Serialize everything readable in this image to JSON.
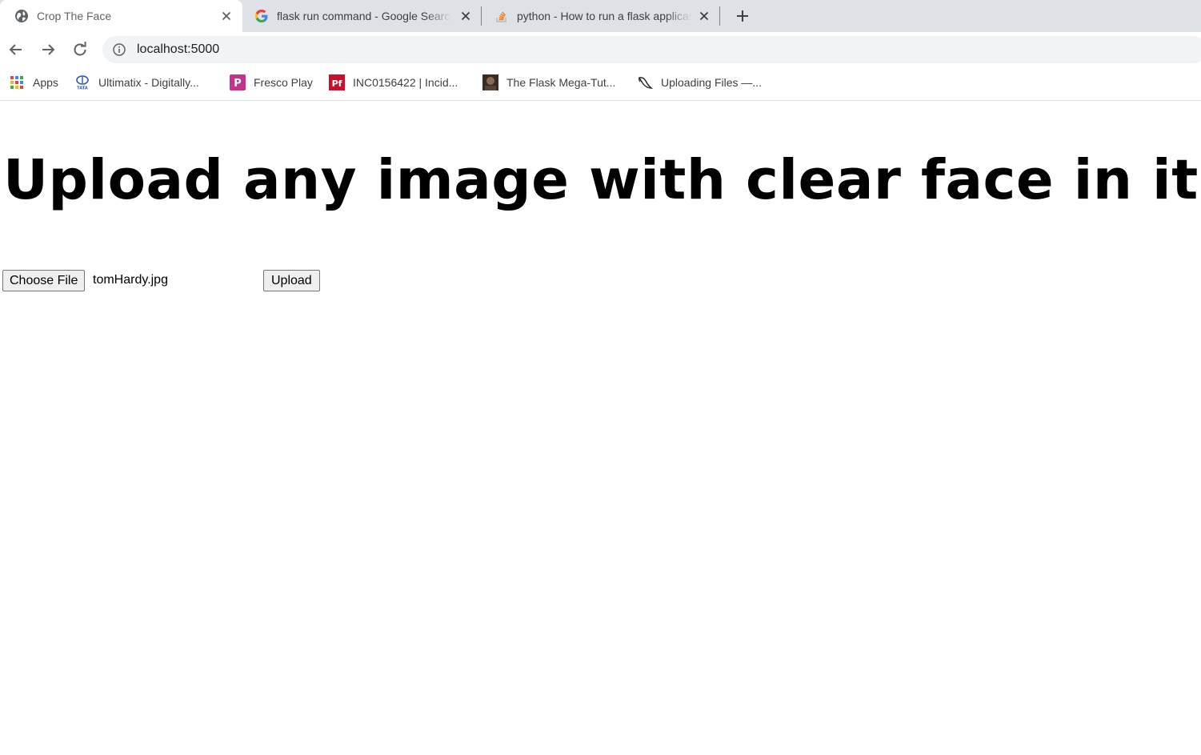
{
  "browser": {
    "tabs": [
      {
        "title": "Crop The Face",
        "icon": "globe-icon",
        "active": true
      },
      {
        "title": "flask run command - Google Search",
        "icon": "google-icon",
        "active": false
      },
      {
        "title": "python - How to run a flask application",
        "icon": "stackoverflow-icon",
        "active": false
      }
    ],
    "new_tab_icon": "plus-icon",
    "address": {
      "url": "localhost:5000",
      "icon": "info-icon"
    },
    "bookmarks": [
      {
        "label": "Apps",
        "icon": "apps-grid-icon"
      },
      {
        "label": "Ultimatix - Digitally...",
        "icon": "tata-icon"
      },
      {
        "label": "Fresco Play",
        "icon": "fresco-icon"
      },
      {
        "label": "INC0156422 | Incid...",
        "icon": "pf-icon"
      },
      {
        "label": "The Flask Mega-Tut...",
        "icon": "avatar-icon"
      },
      {
        "label": "Uploading Files —...",
        "icon": "flask-horn-icon"
      }
    ]
  },
  "page": {
    "heading": "Upload any image with clear face in it.",
    "file_input": {
      "button_label": "Choose File",
      "file_name": "tomHardy.jpg"
    },
    "upload_label": "Upload"
  },
  "colors": {
    "tabstrip": "#dee1e6",
    "omnibox": "#f1f3f4",
    "fresco": "#c2338b",
    "pf": "#c8102e",
    "google_blue": "#4285f4",
    "google_red": "#ea4335",
    "google_yellow": "#fbbc05",
    "google_green": "#34a853",
    "stackoverflow": "#f48024"
  }
}
